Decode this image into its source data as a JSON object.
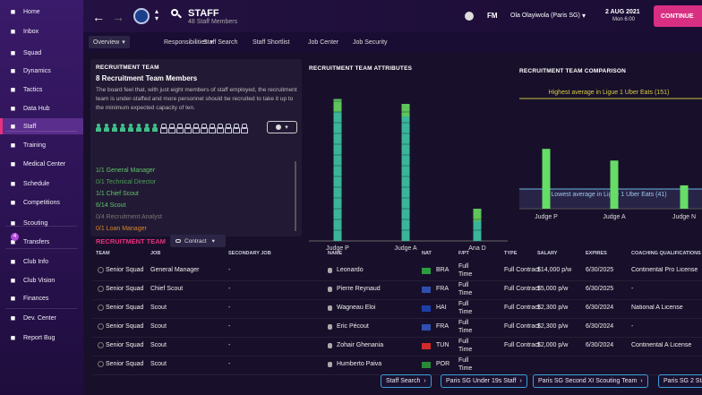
{
  "sidebar": {
    "items": [
      {
        "label": "Home",
        "icon": "home-icon"
      },
      {
        "label": "Inbox",
        "icon": "inbox-icon"
      },
      {
        "label": "Squad",
        "icon": "shirt-icon"
      },
      {
        "label": "Dynamics",
        "icon": "dynamics-icon"
      },
      {
        "label": "Tactics",
        "icon": "tactics-icon"
      },
      {
        "label": "Data Hub",
        "icon": "data-hub-icon"
      },
      {
        "label": "Staff",
        "icon": "staff-icon"
      },
      {
        "label": "Training",
        "icon": "training-icon"
      },
      {
        "label": "Medical Center",
        "icon": "medical-icon"
      },
      {
        "label": "Schedule",
        "icon": "calendar-icon"
      },
      {
        "label": "Competitions",
        "icon": "trophy-icon"
      },
      {
        "label": "Scouting",
        "icon": "scouting-icon"
      },
      {
        "label": "Transfers",
        "icon": "transfers-icon",
        "badge": "4"
      },
      {
        "label": "Club Info",
        "icon": "shield-icon"
      },
      {
        "label": "Club Vision",
        "icon": "vision-icon"
      },
      {
        "label": "Finances",
        "icon": "finances-icon"
      },
      {
        "label": "Dev. Center",
        "icon": "dev-center-icon"
      },
      {
        "label": "Report Bug",
        "icon": "bug-icon"
      }
    ]
  },
  "header": {
    "title": "STAFF",
    "subtitle": "48 Staff Members",
    "fm": "FM",
    "manager": "Ola Olayiwola (Paris SG)",
    "date": "2 AUG 2021",
    "day": "Mon 6:00",
    "continue": "CONTINUE"
  },
  "tabs": [
    "Overview",
    "Responsibilities",
    "Staff Search",
    "Staff Shortlist",
    "Job Center",
    "Job Security"
  ],
  "recruitment": {
    "heading": "RECRUITMENT TEAM",
    "title": "8 Recruitment Team Members",
    "body": "The board feel that, with just eight members of staff employed, the recruitment team is under-staffed and more personnel should be recruited to take it up to the minimum expected capacity of ten.",
    "filled": 8,
    "total": 19,
    "roles": [
      {
        "text": "1/1 General Manager",
        "color": "#5fc46a"
      },
      {
        "text": "0/1 Technical Director",
        "color": "#4a9e57"
      },
      {
        "text": "1/1 Chief Scout",
        "color": "#5fc46a"
      },
      {
        "text": "6/14 Scout",
        "color": "#5fc46a"
      },
      {
        "text": "0/4 Recruitment Analyst",
        "color": "#777"
      },
      {
        "text": "0/1 Loan Manager",
        "color": "#d8842c"
      }
    ]
  },
  "attributes_chart": {
    "heading": "RECRUITMENT TEAM ATTRIBUTES"
  },
  "comparison_chart": {
    "heading": "RECRUITMENT TEAM COMPARISON",
    "highest": "Highest average in Ligue 1 Uber Eats (151)",
    "lowest": "Lowest average in Ligue 1 Uber Eats (41)"
  },
  "chart_data": [
    {
      "type": "bar",
      "title": "RECRUITMENT TEAM ATTRIBUTES",
      "categories": [
        "Judge P",
        "Judge A",
        "Ana D"
      ],
      "values": [
        88,
        85,
        20
      ],
      "ylim": [
        0,
        100
      ]
    },
    {
      "type": "bar",
      "title": "RECRUITMENT TEAM COMPARISON",
      "categories": [
        "Judge P",
        "Judge A",
        "Judge N"
      ],
      "values": [
        82,
        66,
        32
      ],
      "ylim": [
        0,
        151
      ]
    }
  ],
  "table": {
    "section": "RECRUITMENT TEAM",
    "filter": "Contract",
    "headers": [
      "TEAM",
      "JOB",
      "SECONDARY JOB",
      "NAME",
      "NAT",
      "F/PT",
      "TYPE",
      "SALARY",
      "EXPIRES",
      "COACHING QUALIFICATIONS"
    ],
    "rows": [
      {
        "team": "Senior Squad",
        "job": "General Manager",
        "sec": "-",
        "name": "Leonardo",
        "nat": "BRA",
        "fpt": "Full Time",
        "type": "Full Contract",
        "salary": "$14,000 p/w",
        "expires": "6/30/2025",
        "qual": "Continental Pro License"
      },
      {
        "team": "Senior Squad",
        "job": "Chief Scout",
        "sec": "-",
        "name": "Pierre Reynaud",
        "nat": "FRA",
        "fpt": "Full Time",
        "type": "Full Contract",
        "salary": "$5,000 p/w",
        "expires": "6/30/2025",
        "qual": "-"
      },
      {
        "team": "Senior Squad",
        "job": "Scout",
        "sec": "-",
        "name": "Wagneau Eloi",
        "nat": "HAI",
        "fpt": "Full Time",
        "type": "Full Contract",
        "salary": "$2,300 p/w",
        "expires": "6/30/2024",
        "qual": "National A License"
      },
      {
        "team": "Senior Squad",
        "job": "Scout",
        "sec": "-",
        "name": "Eric Pécout",
        "nat": "FRA",
        "fpt": "Full Time",
        "type": "Full Contract",
        "salary": "$2,300 p/w",
        "expires": "6/30/2024",
        "qual": "-"
      },
      {
        "team": "Senior Squad",
        "job": "Scout",
        "sec": "-",
        "name": "Zohair Ghenania",
        "nat": "TUN",
        "fpt": "Full Time",
        "type": "Full Contract",
        "salary": "$2,000 p/w",
        "expires": "6/30/2024",
        "qual": "Continental A License"
      },
      {
        "team": "Senior Squad",
        "job": "Scout",
        "sec": "-",
        "name": "Humberto Paiva",
        "nat": "POR",
        "fpt": "Full Time",
        "type": "",
        "salary": "",
        "expires": "",
        "qual": ""
      }
    ]
  },
  "footer": [
    "Staff Search",
    "Paris SG Under 19s Staff",
    "Paris SG Second XI Scouting Team",
    "Paris SG 2 Sta"
  ]
}
